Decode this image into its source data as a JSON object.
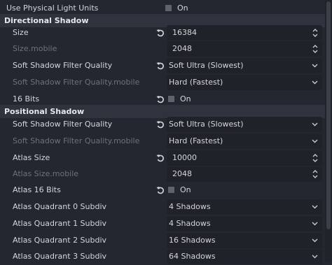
{
  "top": {
    "label": "Use Physical Light Units",
    "value": "On",
    "checked": false
  },
  "directional": {
    "title": "Directional Shadow",
    "size": {
      "label": "Size",
      "value": "16384"
    },
    "size_mobile": {
      "label": "Size.mobile",
      "value": "2048"
    },
    "filter": {
      "label": "Soft Shadow Filter Quality",
      "value": "Soft Ultra (Slowest)"
    },
    "filter_mobile": {
      "label": "Soft Shadow Filter Quality.mobile",
      "value": "Hard (Fastest)"
    },
    "bits16": {
      "label": "16 Bits",
      "value": "On",
      "checked": false
    }
  },
  "positional": {
    "title": "Positional Shadow",
    "filter": {
      "label": "Soft Shadow Filter Quality",
      "value": "Soft Ultra (Slowest)"
    },
    "filter_mobile": {
      "label": "Soft Shadow Filter Quality.mobile",
      "value": "Hard (Fastest)"
    },
    "atlas_size": {
      "label": "Atlas Size",
      "value": "10000"
    },
    "atlas_size_mobile": {
      "label": "Atlas Size.mobile",
      "value": "2048"
    },
    "atlas_16bits": {
      "label": "Atlas 16 Bits",
      "value": "On",
      "checked": false
    },
    "quadrant0": {
      "label": "Atlas Quadrant 0 Subdiv",
      "value": "4 Shadows"
    },
    "quadrant1": {
      "label": "Atlas Quadrant 1 Subdiv",
      "value": "4 Shadows"
    },
    "quadrant2": {
      "label": "Atlas Quadrant 2 Subdiv",
      "value": "16 Shadows"
    },
    "quadrant3": {
      "label": "Atlas Quadrant 3 Subdiv",
      "value": "64 Shadows"
    }
  },
  "icons": {
    "revert": "revert-icon",
    "spin": "spin-arrows-icon",
    "dropdown": "chevron-down-icon"
  },
  "colors": {
    "background": "#242730",
    "field": "#1f2228",
    "section": "#2f333d",
    "checkbox": "#5f636c",
    "dim_text": "#6d717a"
  }
}
